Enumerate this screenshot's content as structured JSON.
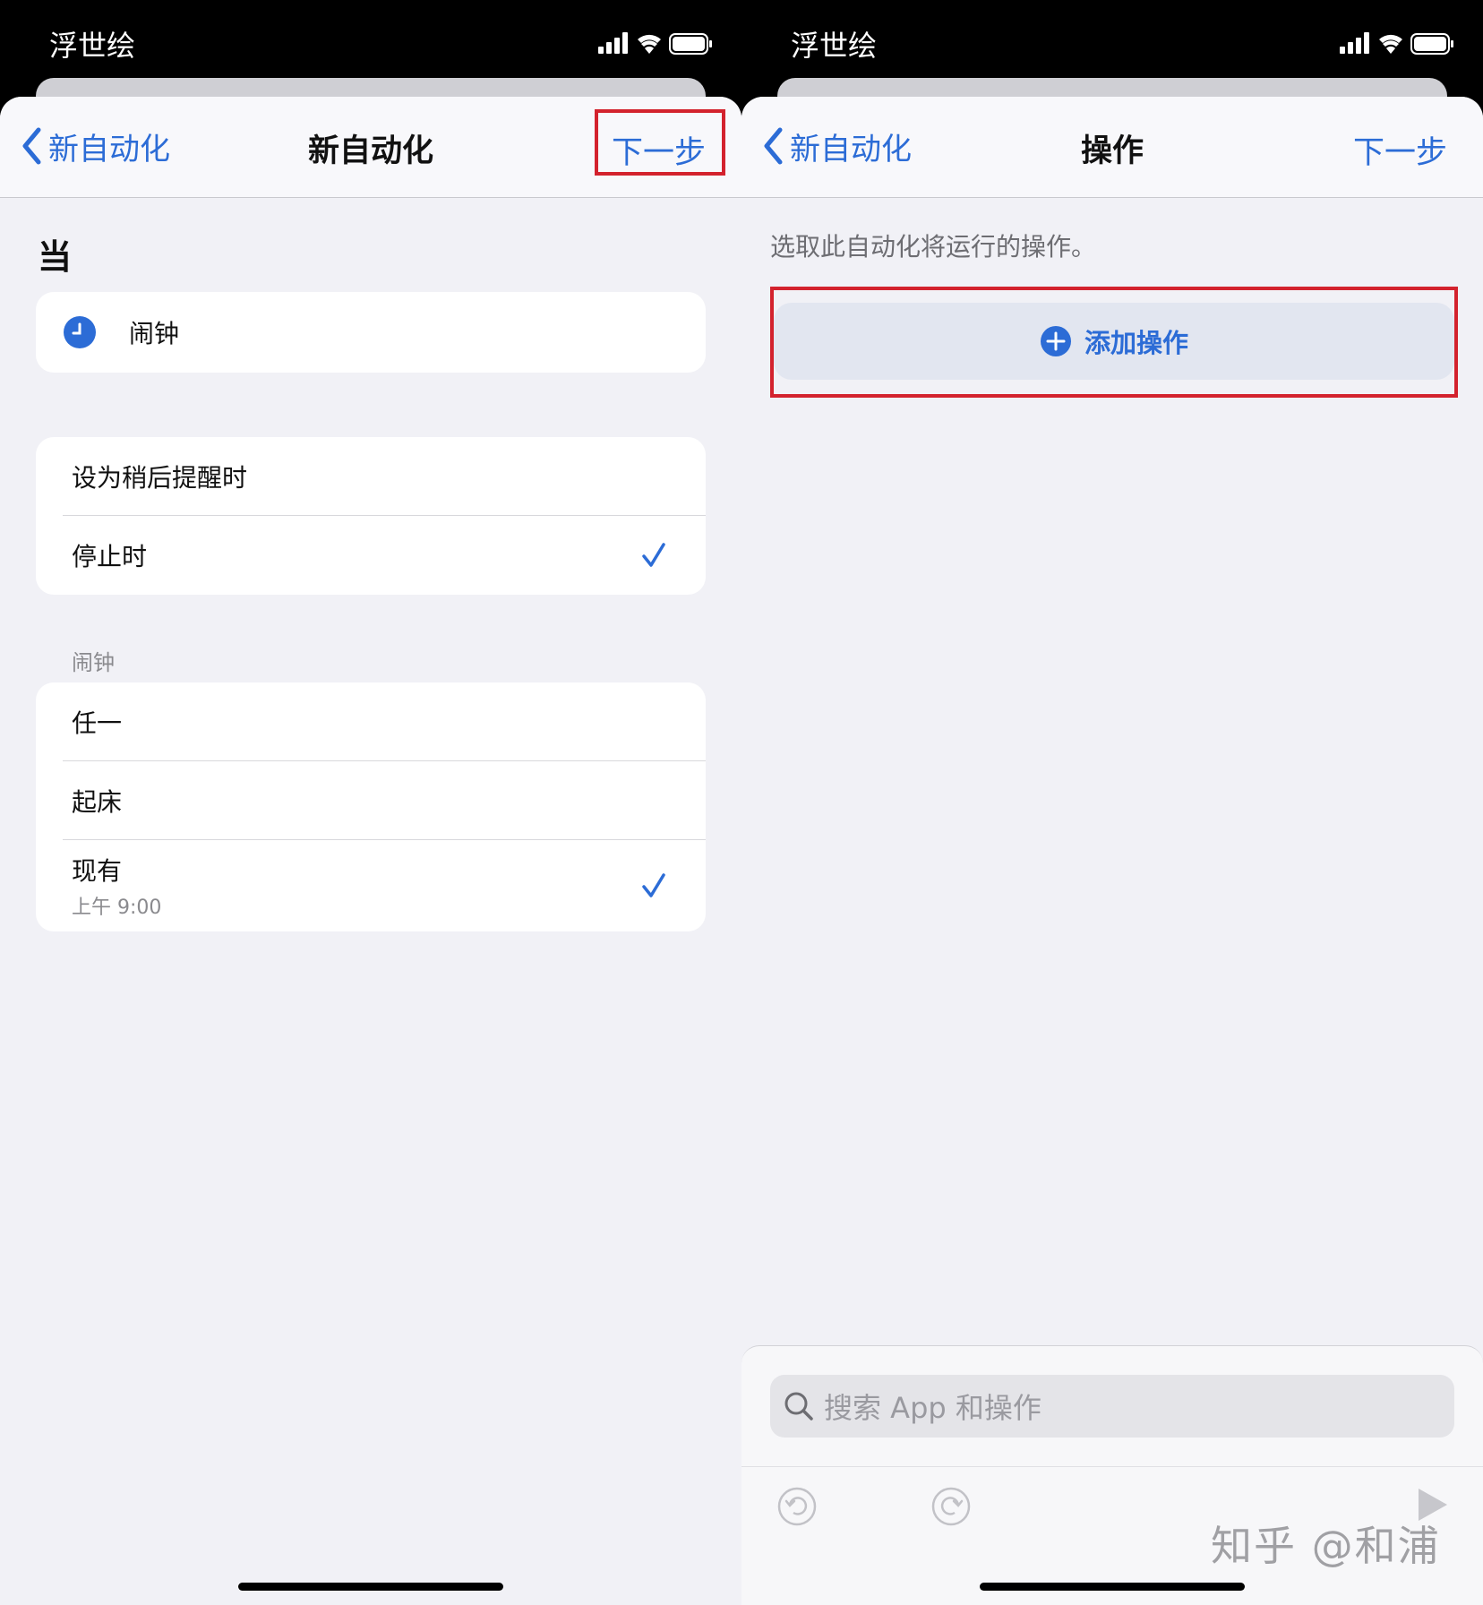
{
  "left": {
    "status": {
      "carrier": "浮世绘"
    },
    "nav": {
      "back": "新自动化",
      "title": "新自动化",
      "next": "下一步"
    },
    "section_title": "当",
    "trigger": {
      "icon": "alarm-clock-icon",
      "label": "闹钟"
    },
    "event_options": [
      {
        "label": "设为稍后提醒时",
        "checked": false
      },
      {
        "label": "停止时",
        "checked": true
      }
    ],
    "alarm_group_label": "闹钟",
    "alarms": [
      {
        "label": "任一",
        "sub": "",
        "checked": false
      },
      {
        "label": "起床",
        "sub": "",
        "checked": false
      },
      {
        "label": "现有",
        "sub": "上午 9:00",
        "checked": true
      }
    ]
  },
  "right": {
    "status": {
      "carrier": "浮世绘"
    },
    "nav": {
      "back": "新自动化",
      "title": "操作",
      "next": "下一步"
    },
    "hint": "选取此自动化将运行的操作。",
    "add_action": "添加操作",
    "search_placeholder": "搜索 App 和操作"
  },
  "watermark": "知乎 @和浦",
  "colors": {
    "accent": "#2c6cd6",
    "highlight": "#d3222d",
    "background": "#f1f1f6"
  }
}
